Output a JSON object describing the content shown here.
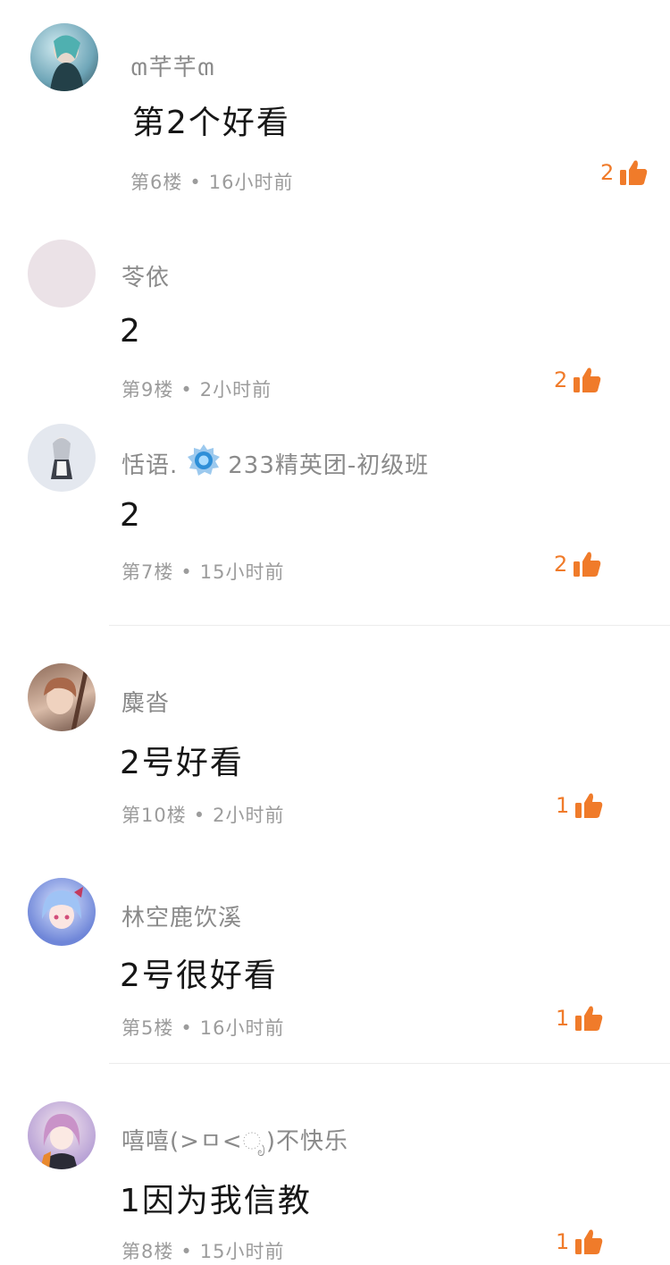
{
  "comments": [
    {
      "name": "ຓ芊芊ຓ",
      "content": "第2个好看",
      "floor": "第6楼",
      "time": "16小时前",
      "likes": "2"
    },
    {
      "name": "苓依",
      "content": "2",
      "floor": "第9楼",
      "time": "2小时前",
      "likes": "2"
    },
    {
      "name": "恬语.",
      "badge": "233精英团-初级班",
      "content": "2",
      "floor": "第7楼",
      "time": "15小时前",
      "likes": "2"
    },
    {
      "name": "麋沓",
      "content": "2号好看",
      "floor": "第10楼",
      "time": "2小时前",
      "likes": "1"
    },
    {
      "name": "林空鹿饮溪",
      "content": "2号很好看",
      "floor": "第5楼",
      "time": "16小时前",
      "likes": "1"
    },
    {
      "name": "嘻嘻(>ㅁ<ೃ)不快乐",
      "content": "1因为我信教",
      "floor": "第8楼",
      "time": "15小时前",
      "likes": "1"
    }
  ],
  "separator": "•",
  "colors": {
    "accent": "#f07b2a",
    "meta": "#9c9c9c",
    "name": "#8a8a8a",
    "divider": "#ececec"
  },
  "icons": {
    "like": "thumbs-up-icon",
    "badge": "medal-badge-icon"
  }
}
